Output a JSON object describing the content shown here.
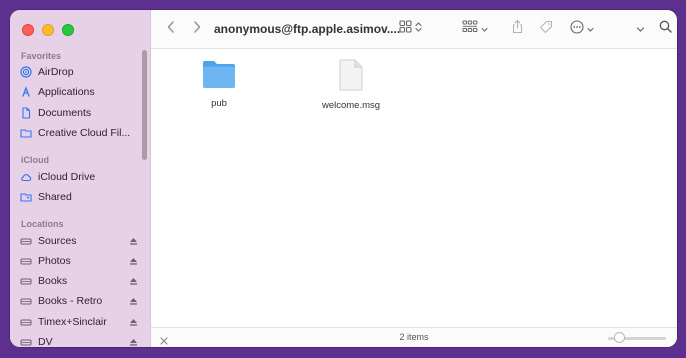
{
  "window": {
    "title": "anonymous@ftp.apple.asimov...."
  },
  "sidebar": {
    "favorites_header": "Favorites",
    "favorites": [
      {
        "label": "AirDrop",
        "icon": "airdrop-icon"
      },
      {
        "label": "Applications",
        "icon": "applications-icon"
      },
      {
        "label": "Documents",
        "icon": "document-icon"
      },
      {
        "label": "Creative Cloud Fil...",
        "icon": "folder-icon"
      }
    ],
    "icloud_header": "iCloud",
    "icloud": [
      {
        "label": "iCloud Drive",
        "icon": "cloud-icon"
      },
      {
        "label": "Shared",
        "icon": "shared-folder-icon"
      }
    ],
    "locations_header": "Locations",
    "locations": [
      {
        "label": "Sources",
        "icon": "drive-icon"
      },
      {
        "label": "Photos",
        "icon": "drive-icon"
      },
      {
        "label": "Books",
        "icon": "drive-icon"
      },
      {
        "label": "Books - Retro",
        "icon": "drive-icon"
      },
      {
        "label": "Timex+Sinclair",
        "icon": "drive-icon"
      },
      {
        "label": "DV",
        "icon": "drive-icon"
      }
    ]
  },
  "files": [
    {
      "name": "pub",
      "icon": "folder-icon"
    },
    {
      "name": "welcome.msg",
      "icon": "document-icon"
    }
  ],
  "status": {
    "item_count": "2 items"
  },
  "colors": {
    "sidebar_bg": "#e7d1e7",
    "accent": "#3478f6",
    "folder_blue": "#6eb6f2"
  }
}
